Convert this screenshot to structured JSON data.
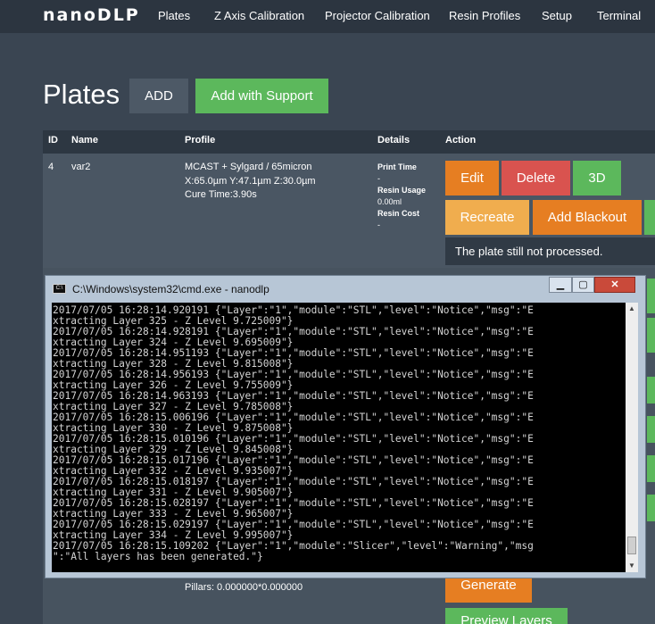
{
  "nav": {
    "logo": "nanoDLP",
    "links": [
      "Plates",
      "Z Axis Calibration",
      "Projector Calibration",
      "Resin Profiles",
      "Setup",
      "Terminal"
    ]
  },
  "page": {
    "title": "Plates",
    "add_label": "ADD",
    "add_support_label": "Add with Support"
  },
  "table": {
    "headers": [
      "ID",
      "Name",
      "Profile",
      "Details",
      "Action"
    ],
    "row": {
      "id": "4",
      "name": "var2",
      "profile_line1": "MCAST + Sylgard / 65micron",
      "profile_line2": "X:65.0µm Y:47.1µm Z:30.0µm",
      "profile_line3": "Cure Time:3.90s",
      "details": {
        "print_time_label": "Print Time",
        "print_time_value": "-",
        "resin_usage_label": "Resin Usage",
        "resin_usage_value": "0.00ml",
        "resin_cost_label": "Resin Cost",
        "resin_cost_value": "-"
      },
      "actions": {
        "edit": "Edit",
        "delete": "Delete",
        "view3d": "3D",
        "recreate": "Recreate",
        "add_blackout": "Add Blackout"
      },
      "notice": "The plate still not processed."
    },
    "row2": {
      "pillars": "Pillars: 0.000000*0.000000",
      "generate": "Generate",
      "preview_layers": "Preview Layers"
    }
  },
  "cmd": {
    "title": "C:\\Windows\\system32\\cmd.exe - nanodlp",
    "icon_text": "C:\\",
    "minimize": "▁",
    "maximize": "▢",
    "close": "✕",
    "lines": [
      "2017/07/05 16:28:14.920191 {\"Layer\":\"1\",\"module\":\"STL\",\"level\":\"Notice\",\"msg\":\"E",
      "xtracting Layer 325 - Z Level 9.725009\"}",
      "2017/07/05 16:28:14.928191 {\"Layer\":\"1\",\"module\":\"STL\",\"level\":\"Notice\",\"msg\":\"E",
      "xtracting Layer 324 - Z Level 9.695009\"}",
      "2017/07/05 16:28:14.951193 {\"Layer\":\"1\",\"module\":\"STL\",\"level\":\"Notice\",\"msg\":\"E",
      "xtracting Layer 328 - Z Level 9.815008\"}",
      "2017/07/05 16:28:14.956193 {\"Layer\":\"1\",\"module\":\"STL\",\"level\":\"Notice\",\"msg\":\"E",
      "xtracting Layer 326 - Z Level 9.755009\"}",
      "2017/07/05 16:28:14.963193 {\"Layer\":\"1\",\"module\":\"STL\",\"level\":\"Notice\",\"msg\":\"E",
      "xtracting Layer 327 - Z Level 9.785008\"}",
      "2017/07/05 16:28:15.006196 {\"Layer\":\"1\",\"module\":\"STL\",\"level\":\"Notice\",\"msg\":\"E",
      "xtracting Layer 330 - Z Level 9.875008\"}",
      "2017/07/05 16:28:15.010196 {\"Layer\":\"1\",\"module\":\"STL\",\"level\":\"Notice\",\"msg\":\"E",
      "xtracting Layer 329 - Z Level 9.845008\"}",
      "2017/07/05 16:28:15.017196 {\"Layer\":\"1\",\"module\":\"STL\",\"level\":\"Notice\",\"msg\":\"E",
      "xtracting Layer 332 - Z Level 9.935007\"}",
      "2017/07/05 16:28:15.018197 {\"Layer\":\"1\",\"module\":\"STL\",\"level\":\"Notice\",\"msg\":\"E",
      "xtracting Layer 331 - Z Level 9.905007\"}",
      "2017/07/05 16:28:15.028197 {\"Layer\":\"1\",\"module\":\"STL\",\"level\":\"Notice\",\"msg\":\"E",
      "xtracting Layer 333 - Z Level 9.965007\"}",
      "2017/07/05 16:28:15.029197 {\"Layer\":\"1\",\"module\":\"STL\",\"level\":\"Notice\",\"msg\":\"E",
      "xtracting Layer 334 - Z Level 9.995007\"}",
      "2017/07/05 16:28:15.109202 {\"Layer\":\"1\",\"module\":\"Slicer\",\"level\":\"Warning\",\"msg",
      "\":\"All layers has been generated.\"}"
    ]
  },
  "colors": {
    "background": "#3a4552",
    "navbar": "#2c3540",
    "green": "#5cb85c",
    "orange": "#e67e22",
    "red": "#d9534f"
  }
}
